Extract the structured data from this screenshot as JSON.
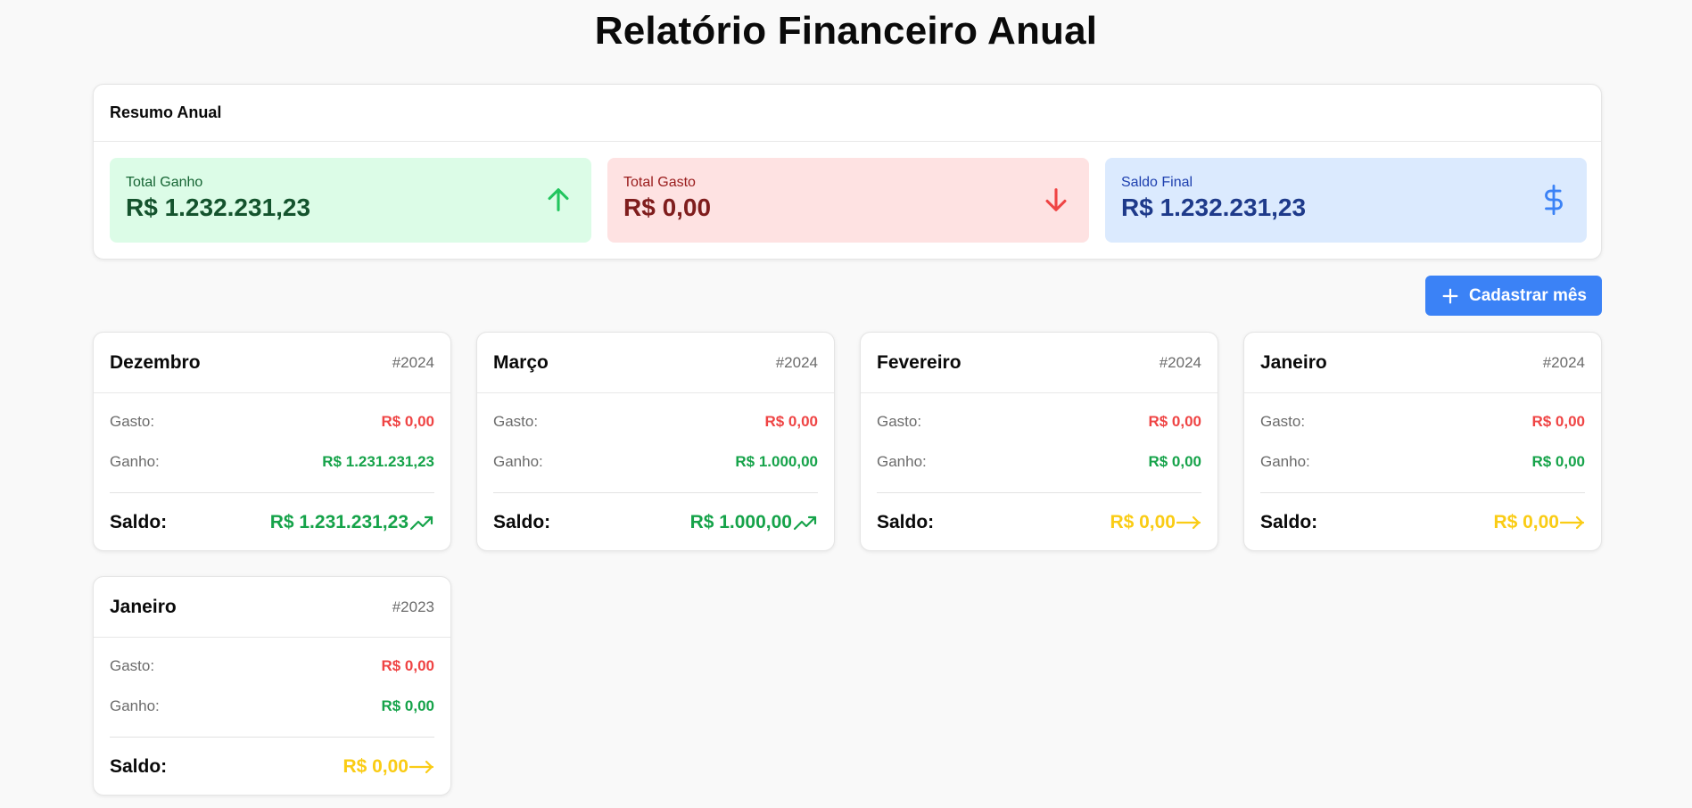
{
  "page_title": "Relatório Financeiro Anual",
  "summary": {
    "title": "Resumo Anual",
    "stats": [
      {
        "label": "Total Ganho",
        "value": "R$ 1.232.231,23",
        "icon": "arrow-up-icon",
        "color": "#22c55e"
      },
      {
        "label": "Total Gasto",
        "value": "R$ 0,00",
        "icon": "arrow-down-icon",
        "color": "#ef4444"
      },
      {
        "label": "Saldo Final",
        "value": "R$ 1.232.231,23",
        "icon": "dollar-icon",
        "color": "#3b82f6"
      }
    ]
  },
  "add_button": {
    "label": "Cadastrar mês",
    "icon": "plus-icon"
  },
  "months": [
    {
      "name": "Dezembro",
      "year": "#2024",
      "gasto_label": "Gasto:",
      "gasto": "R$ 0,00",
      "ganho_label": "Ganho:",
      "ganho": "R$ 1.231.231,23",
      "saldo_label": "Saldo:",
      "saldo": "R$ 1.231.231,23",
      "trend": "trending-up-icon"
    },
    {
      "name": "Março",
      "year": "#2024",
      "gasto_label": "Gasto:",
      "gasto": "R$ 0,00",
      "ganho_label": "Ganho:",
      "ganho": "R$ 1.000,00",
      "saldo_label": "Saldo:",
      "saldo": "R$ 1.000,00",
      "trend": "trending-up-icon"
    },
    {
      "name": "Fevereiro",
      "year": "#2024",
      "gasto_label": "Gasto:",
      "gasto": "R$ 0,00",
      "ganho_label": "Ganho:",
      "ganho": "R$ 0,00",
      "saldo_label": "Saldo:",
      "saldo": "R$ 0,00",
      "trend": "arrow-right-icon"
    },
    {
      "name": "Janeiro",
      "year": "#2024",
      "gasto_label": "Gasto:",
      "gasto": "R$ 0,00",
      "ganho_label": "Ganho:",
      "ganho": "R$ 0,00",
      "saldo_label": "Saldo:",
      "saldo": "R$ 0,00",
      "trend": "arrow-right-icon"
    },
    {
      "name": "Janeiro",
      "year": "#2023",
      "gasto_label": "Gasto:",
      "gasto": "R$ 0,00",
      "ganho_label": "Ganho:",
      "ganho": "R$ 0,00",
      "saldo_label": "Saldo:",
      "saldo": "R$ 0,00",
      "trend": "arrow-right-icon"
    }
  ],
  "colors": {
    "accent": "#3b82f6",
    "positive": "#16a34a",
    "negative": "#ef4444",
    "neutral": "#facc15"
  }
}
